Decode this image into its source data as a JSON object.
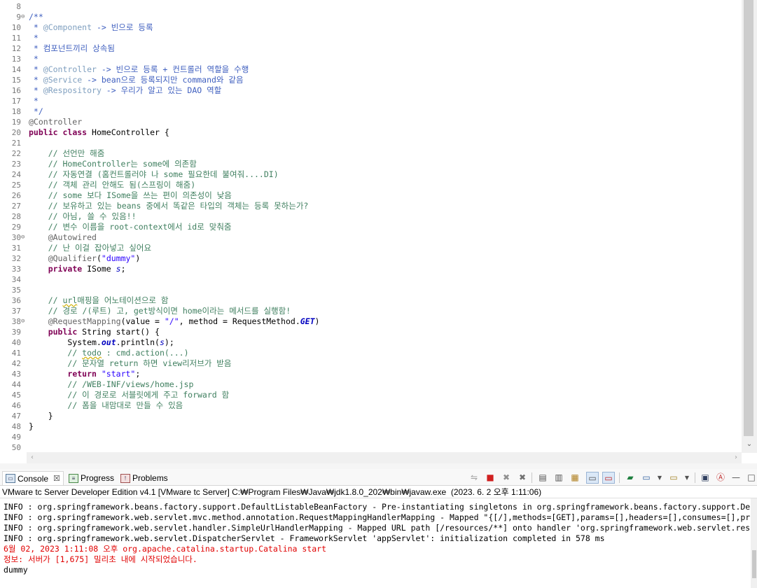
{
  "editor": {
    "lines": [
      {
        "n": "8",
        "fold": "",
        "html": ""
      },
      {
        "n": "9",
        "fold": "⊖",
        "html": "<span class='jd'>/**</span>"
      },
      {
        "n": "10",
        "fold": "",
        "html": "<span class='jd'> * </span><span class='jdt'>@Component</span><span class='jd'> -&gt; 빈으로 등록</span>"
      },
      {
        "n": "11",
        "fold": "",
        "html": "<span class='jd'> *</span>"
      },
      {
        "n": "12",
        "fold": "",
        "html": "<span class='jd'> * 컴포넌트끼리 상속됨</span>"
      },
      {
        "n": "13",
        "fold": "",
        "html": "<span class='jd'> *</span>"
      },
      {
        "n": "14",
        "fold": "",
        "html": "<span class='jd'> * </span><span class='jdt'>@Controller</span><span class='jd'> -&gt; 빈으로 등록 + 컨트롤러 역할을 수행</span>"
      },
      {
        "n": "15",
        "fold": "",
        "html": "<span class='jd'> * </span><span class='jdt'>@Service</span><span class='jd'> -&gt; bean으로 등록되지만 command와 같음</span>"
      },
      {
        "n": "16",
        "fold": "",
        "html": "<span class='jd'> * </span><span class='jdt'>@Respository</span><span class='jd'> -&gt; 우리가 알고 있는 DAO 역할</span>"
      },
      {
        "n": "17",
        "fold": "",
        "html": "<span class='jd'> *</span>"
      },
      {
        "n": "18",
        "fold": "",
        "html": "<span class='jd'> */</span>"
      },
      {
        "n": "19",
        "fold": "",
        "html": "<span class='an'>@Controller</span>"
      },
      {
        "n": "20",
        "fold": "",
        "html": "<span class='kw'>public</span> <span class='kw'>class</span> HomeController {"
      },
      {
        "n": "21",
        "fold": "",
        "html": ""
      },
      {
        "n": "22",
        "fold": "",
        "html": "    <span class='cm'>// 선언만 해줌</span>"
      },
      {
        "n": "23",
        "fold": "",
        "html": "    <span class='cm'>// HomeController는 some에 의존함</span>"
      },
      {
        "n": "24",
        "fold": "",
        "html": "    <span class='cm'>// 자동연결 (홈컨트롤러야 나 some 필요한데 불여줘....DI)</span>"
      },
      {
        "n": "25",
        "fold": "",
        "html": "    <span class='cm'>// 객체 관리 안해도 됨(스프링이 해줌)</span>"
      },
      {
        "n": "26",
        "fold": "",
        "html": "    <span class='cm'>// some 보다 ISome을 쓰는 편이 의존성이 낮음</span>"
      },
      {
        "n": "27",
        "fold": "",
        "html": "    <span class='cm'>// 보유하고 있는 beans 중에서 똑같은 타입의 객체는 등록 못하는가?</span>"
      },
      {
        "n": "28",
        "fold": "",
        "html": "    <span class='cm'>// 아님, 쓸 수 있음!!</span>"
      },
      {
        "n": "29",
        "fold": "",
        "html": "    <span class='cm'>// 변수 이름을 root-context에서 id로 맞춰줌</span>"
      },
      {
        "n": "30",
        "fold": "⊖",
        "html": "    <span class='an'>@Autowired</span>"
      },
      {
        "n": "31",
        "fold": "",
        "html": "    <span class='cm'>// 난 이걸 잡아넣고 싶어요</span>"
      },
      {
        "n": "32",
        "fold": "",
        "html": "    <span class='an'>@Qualifier</span>(<span class='str'>\"dummy\"</span>)"
      },
      {
        "n": "33",
        "fold": "",
        "html": "    <span class='kw'>private</span> ISome <span class='itc'>s</span>;"
      },
      {
        "n": "34",
        "fold": "",
        "html": ""
      },
      {
        "n": "35",
        "fold": "",
        "html": ""
      },
      {
        "n": "36",
        "fold": "",
        "html": "    <span class='cm'>// <span class='sq'>url</span>매핑을 어노테이션으로 함</span>"
      },
      {
        "n": "37",
        "fold": "",
        "html": "    <span class='cm'>// 경로 /(루트) 고, get방식이면 home이라는 메서드를 실행함!</span>"
      },
      {
        "n": "38",
        "fold": "⊖",
        "html": "    <span class='an'>@RequestMapping</span>(value = <span class='str'>\"/\"</span>, method = RequestMethod.<span class='it'>GET</span>)"
      },
      {
        "n": "39",
        "fold": "",
        "html": "    <span class='kw'>public</span> String start() {"
      },
      {
        "n": "40",
        "fold": "",
        "html": "        System.<span class='it'>out</span>.println(<span class='itc'>s</span>);"
      },
      {
        "n": "41",
        "fold": "",
        "html": "        <span class='cm'>// <span class='sq'>todo</span> : cmd.action(...)</span>"
      },
      {
        "n": "42",
        "fold": "",
        "html": "        <span class='cm'>// 문자열 return 하면 view리저브가 받음</span>"
      },
      {
        "n": "43",
        "fold": "",
        "html": "        <span class='kw'>return</span> <span class='str'>\"start\"</span>;"
      },
      {
        "n": "44",
        "fold": "",
        "html": "        <span class='cm'>// /WEB-INF/views/home.jsp</span>"
      },
      {
        "n": "45",
        "fold": "",
        "html": "        <span class='cm'>// 이 경로로 서블릿에게 주고 forward 함</span>"
      },
      {
        "n": "46",
        "fold": "",
        "html": "        <span class='cm'>// 폼을 내맘대로 만들 수 있음</span>"
      },
      {
        "n": "47",
        "fold": "",
        "html": "    }"
      },
      {
        "n": "48",
        "fold": "",
        "html": "}"
      },
      {
        "n": "49",
        "fold": "",
        "html": ""
      },
      {
        "n": "50",
        "fold": "",
        "html": ""
      }
    ]
  },
  "panel": {
    "tabs": {
      "console": "Console",
      "progress": "Progress",
      "problems": "Problems"
    },
    "console_title": "VMware tc Server Developer Edition v4.1 [VMware tc Server] C:₩Program Files₩Java₩jdk1.8.0_202₩bin₩javaw.exe  (2023. 6. 2 오후 1:11:06)",
    "console_lines": [
      {
        "text": "INFO : org.springframework.beans.factory.support.DefaultListableBeanFactory - Pre-instantiating singletons in org.springframework.beans.factory.support.DefaultListableBeanFactory",
        "err": false
      },
      {
        "text": "INFO : org.springframework.web.servlet.mvc.method.annotation.RequestMappingHandlerMapping - Mapped \"{[/],methods=[GET],params=[],headers=[],consumes=[],produces=[],custom=[]}\"",
        "err": false
      },
      {
        "text": "INFO : org.springframework.web.servlet.handler.SimpleUrlHandlerMapping - Mapped URL path [/resources/**] onto handler 'org.springframework.web.servlet.resource.ResourceHttpRequestHandler'",
        "err": false
      },
      {
        "text": "INFO : org.springframework.web.servlet.DispatcherServlet - FrameworkServlet 'appServlet': initialization completed in 578 ms",
        "err": false
      },
      {
        "text": "6월 02, 2023 1:11:08 오후 org.apache.catalina.startup.Catalina start",
        "err": true
      },
      {
        "text": "정보: 서버가 [1,675] 밀리초 내에 시작되었습니다.",
        "err": true
      },
      {
        "text": "dummy",
        "err": false
      }
    ]
  }
}
